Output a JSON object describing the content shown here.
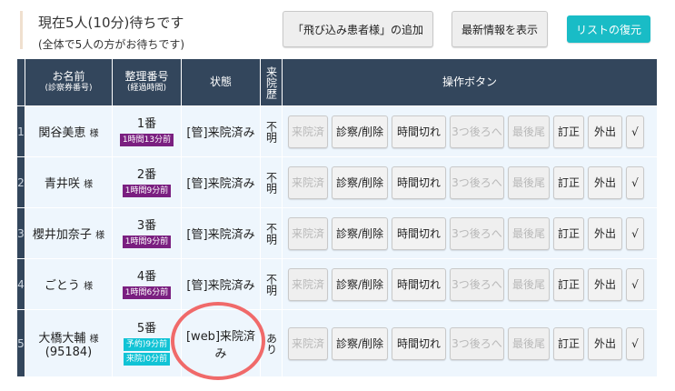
{
  "header": {
    "title": "現在5人(10分)待ちです",
    "subtitle": "(全体で5人の方がお待ちです)",
    "buttons": {
      "add_walkin": "「飛び込み患者様」の追加",
      "refresh": "最新情報を表示",
      "restore": "リストの復元"
    }
  },
  "table": {
    "headers": {
      "name": "お名前",
      "name_sub": "(診察券番号)",
      "number": "整理番号",
      "number_sub": "(経過時間)",
      "status": "状態",
      "history": "来院歴",
      "actions": "操作ボタン"
    },
    "honorific": "様",
    "action_labels": [
      "来院済",
      "診察/削除",
      "時間切れ",
      "3つ後ろへ",
      "最後尾",
      "訂正",
      "外出",
      "√"
    ],
    "rows": [
      {
        "index": "1",
        "name": "関谷美恵",
        "card": "",
        "number": "1番",
        "badges": [
          {
            "text": "1時間13分前",
            "color": "purple"
          }
        ],
        "status": "[管]来院済み",
        "history": "不明"
      },
      {
        "index": "2",
        "name": "青井咲",
        "card": "",
        "number": "2番",
        "badges": [
          {
            "text": "1時間9分前",
            "color": "purple"
          }
        ],
        "status": "[管]来院済み",
        "history": "不明"
      },
      {
        "index": "3",
        "name": "櫻井加奈子",
        "card": "",
        "number": "3番",
        "badges": [
          {
            "text": "1時間9分前",
            "color": "purple"
          }
        ],
        "status": "[管]来院済み",
        "history": "不明"
      },
      {
        "index": "4",
        "name": "ごとう",
        "card": "",
        "number": "4番",
        "badges": [
          {
            "text": "1時間6分前",
            "color": "purple"
          }
        ],
        "status": "[管]来院済み",
        "history": "不明"
      },
      {
        "index": "5",
        "name": "大橋大輔",
        "card": "(95184)",
        "number": "5番",
        "badges": [
          {
            "text": "予約)9分前",
            "color": "cyan"
          },
          {
            "text": "来院)0分前",
            "color": "cyan"
          }
        ],
        "status": "[web]来院済み",
        "history": "あり"
      }
    ]
  },
  "colors": {
    "header_bg": "#33465c",
    "row_bg": "#eef6fd",
    "purple_badge": "#7a1f80",
    "cyan_badge": "#11c3d5",
    "restore_button": "#19bcc6",
    "highlight_circle": "#f06a6a"
  }
}
